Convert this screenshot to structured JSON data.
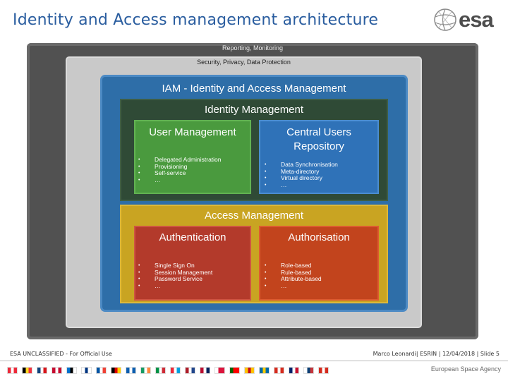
{
  "header": {
    "title": "Identity and Access management architecture",
    "logo_text": "esa"
  },
  "diagram": {
    "outer_label": "Reporting, Monitoring",
    "security_label": "Security, Privacy, Data Protection",
    "iam_label": "IAM - Identity and Access Management",
    "identity": {
      "label": "Identity Management",
      "user_mgmt": {
        "title": "User Management",
        "items": [
          "Delegated Administration",
          "Provisioning",
          "Self-service",
          "…"
        ]
      },
      "central_repo": {
        "title_line1": "Central Users",
        "title_line2": "Repository",
        "items": [
          "Data Synchronisation",
          "Meta-directory",
          "Virtual directory",
          "…"
        ]
      }
    },
    "access": {
      "label": "Access Management",
      "authentication": {
        "title": "Authentication",
        "items": [
          "Single Sign On",
          "Session Management",
          "Password Service",
          "…"
        ]
      },
      "authorisation": {
        "title": "Authorisation",
        "items": [
          "Role-based",
          "Rule-based",
          "Attribute-based",
          "…"
        ]
      }
    }
  },
  "footer": {
    "classification": "ESA UNCLASSIFIED - For Official Use",
    "author_info": "Marco Leonardi| ESRIN | 12/04/2018 | Slide  5",
    "agency": "European Space Agency",
    "flag_colors": [
      [
        "#ed2939",
        "#ffffff",
        "#ed2939"
      ],
      [
        "#000000",
        "#fdda24",
        "#ef3340"
      ],
      [
        "#11457e",
        "#ffffff",
        "#d7141a"
      ],
      [
        "#c60c30",
        "#ffffff",
        "#c60c30"
      ],
      [
        "#0072ce",
        "#000000",
        "#ffffff"
      ],
      [
        "#ffffff",
        "#003580",
        "#ffffff"
      ],
      [
        "#0055a4",
        "#ffffff",
        "#ef4135"
      ],
      [
        "#000000",
        "#dd0000",
        "#ffce00"
      ],
      [
        "#0d5eaf",
        "#ffffff",
        "#0d5eaf"
      ],
      [
        "#169b62",
        "#ffffff",
        "#ff883e"
      ],
      [
        "#009246",
        "#ffffff",
        "#ce2b37"
      ],
      [
        "#ed2939",
        "#ffffff",
        "#00a1de"
      ],
      [
        "#ae1c28",
        "#ffffff",
        "#21468b"
      ],
      [
        "#ba0c2f",
        "#ffffff",
        "#00205b"
      ],
      [
        "#ffffff",
        "#dc143c",
        "#dc143c"
      ],
      [
        "#006600",
        "#ff0000",
        "#ff0000"
      ],
      [
        "#ffc400",
        "#c60b1e",
        "#ffc400"
      ],
      [
        "#006aa7",
        "#fecc00",
        "#006aa7"
      ],
      [
        "#d52b1e",
        "#ffffff",
        "#d52b1e"
      ],
      [
        "#012169",
        "#ffffff",
        "#c8102e"
      ],
      [
        "#ffffff",
        "#0c4076",
        "#c6363c"
      ],
      [
        "#d52b1e",
        "#ffffff",
        "#d52b1e"
      ]
    ]
  }
}
